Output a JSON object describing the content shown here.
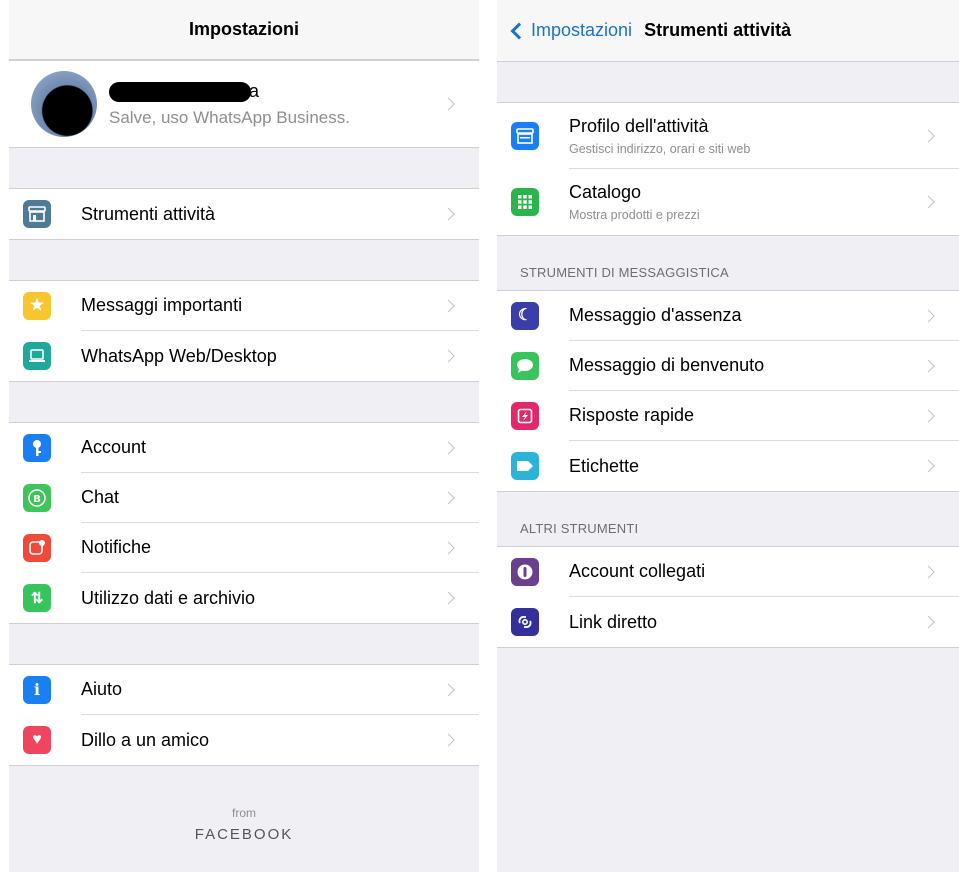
{
  "colors": {
    "ios_blue": "#1a73c7",
    "background": "#efeff4",
    "secondary_text": "#8e8e93"
  },
  "left": {
    "title": "Impostazioni",
    "profile": {
      "name_visible": "a",
      "status": "Salve, uso WhatsApp Business."
    },
    "group1": [
      {
        "label": "Strumenti attività",
        "icon": "store-icon",
        "color": "#4f7a93"
      }
    ],
    "group2": [
      {
        "label": "Messaggi importanti",
        "icon": "star-icon",
        "color": "#f7c52d"
      },
      {
        "label": "WhatsApp Web/Desktop",
        "icon": "laptop-icon",
        "color": "#1fa99a"
      }
    ],
    "group3": [
      {
        "label": "Account",
        "icon": "key-icon",
        "color": "#1a7ff0"
      },
      {
        "label": "Chat",
        "icon": "whatsapp-business-icon",
        "color": "#3fc45a"
      },
      {
        "label": "Notifiche",
        "icon": "notification-icon",
        "color": "#f04a3a"
      },
      {
        "label": "Utilizzo dati e archivio",
        "icon": "data-arrows-icon",
        "color": "#37c45c"
      }
    ],
    "group4": [
      {
        "label": "Aiuto",
        "icon": "info-icon",
        "color": "#1a7ff0"
      },
      {
        "label": "Dillo a un amico",
        "icon": "heart-icon",
        "color": "#f04560"
      }
    ],
    "footer": {
      "from": "from",
      "brand": "FACEBOOK"
    }
  },
  "right": {
    "back_label": "Impostazioni",
    "title": "Strumenti attività",
    "group1": [
      {
        "label": "Profilo dell'attività",
        "sub": "Gestisci indirizzo, orari e siti web",
        "icon": "store-icon",
        "color": "#1a7ff0"
      },
      {
        "label": "Catalogo",
        "sub": "Mostra prodotti e prezzi",
        "icon": "grid-icon",
        "color": "#2ab44a"
      }
    ],
    "section_messaging": "STRUMENTI DI MESSAGGISTICA",
    "group2": [
      {
        "label": "Messaggio d'assenza",
        "icon": "moon-icon",
        "color": "#3a3ea8"
      },
      {
        "label": "Messaggio di benvenuto",
        "icon": "chat-bubble-icon",
        "color": "#37c45c"
      },
      {
        "label": "Risposte rapide",
        "icon": "lightning-icon",
        "color": "#e2286b"
      },
      {
        "label": "Etichette",
        "icon": "label-tag-icon",
        "color": "#2bb3d8"
      }
    ],
    "section_other": "ALTRI STRUMENTI",
    "group3": [
      {
        "label": "Account collegati",
        "icon": "linked-account-icon",
        "color": "#6a3f8e"
      },
      {
        "label": "Link diretto",
        "icon": "link-icon",
        "color": "#34309a"
      }
    ]
  }
}
